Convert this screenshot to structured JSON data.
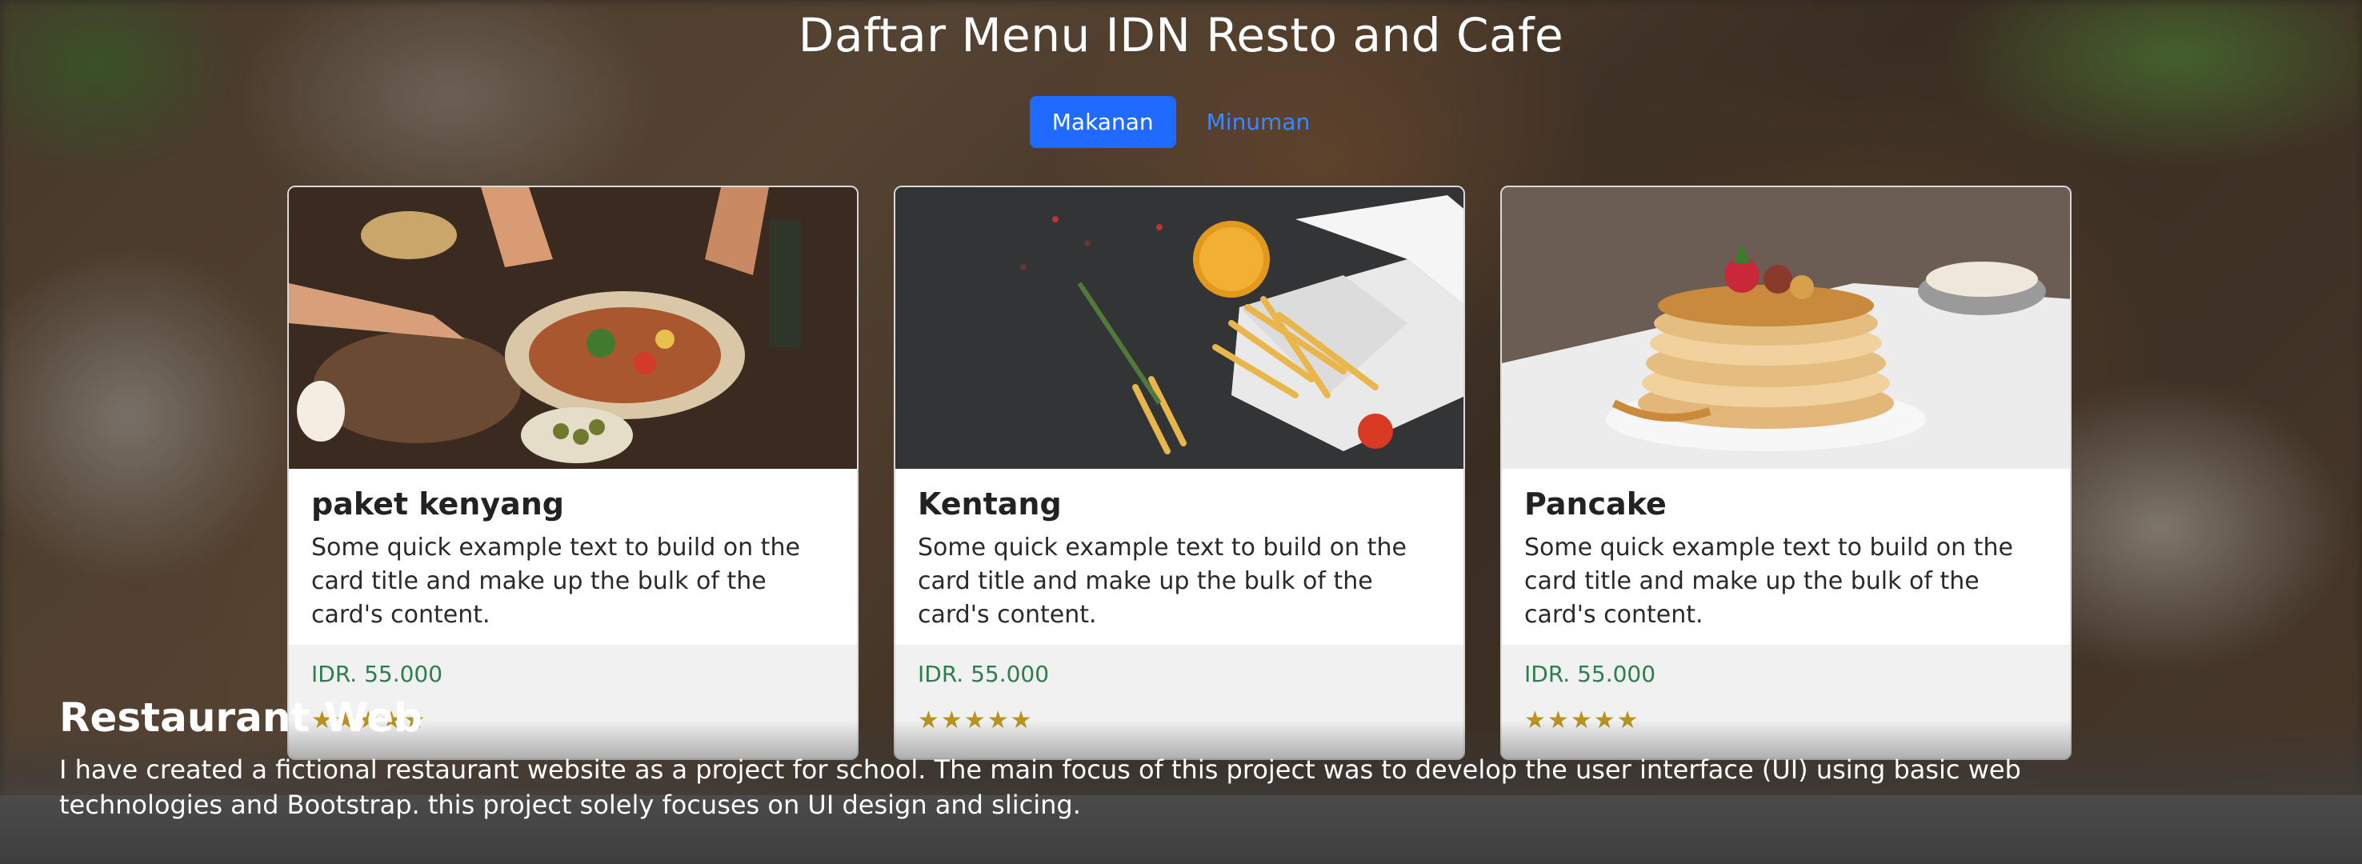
{
  "page": {
    "title": "Daftar Menu IDN Resto and Cafe"
  },
  "tabs": [
    {
      "label": "Makanan",
      "active": true
    },
    {
      "label": "Minuman",
      "active": false
    }
  ],
  "cards": [
    {
      "title": "paket kenyang",
      "text": "Some quick example text to build on the card title and make up the bulk of the card's content.",
      "price": "IDR. 55.000",
      "rating": 5,
      "image": "party-feast-image"
    },
    {
      "title": "Kentang",
      "text": "Some quick example text to build on the card title and make up the bulk of the card's content.",
      "price": "IDR. 55.000",
      "rating": 5,
      "image": "french-fries-image"
    },
    {
      "title": "Pancake",
      "text": "Some quick example text to build on the card title and make up the bulk of the card's content.",
      "price": "IDR. 55.000",
      "rating": 5,
      "image": "pancake-stack-image"
    }
  ],
  "caption": {
    "title": "Restaurant Web",
    "text": "I have created a fictional restaurant website as a project for school. The main focus of this project was to develop the user interface (UI) using basic web technologies and Bootstrap. this project solely focuses on UI design and slicing."
  },
  "colors": {
    "primary": "#1f6bff",
    "link": "#3d86ff",
    "price": "#2e7d4f",
    "star": "#b8941f"
  }
}
